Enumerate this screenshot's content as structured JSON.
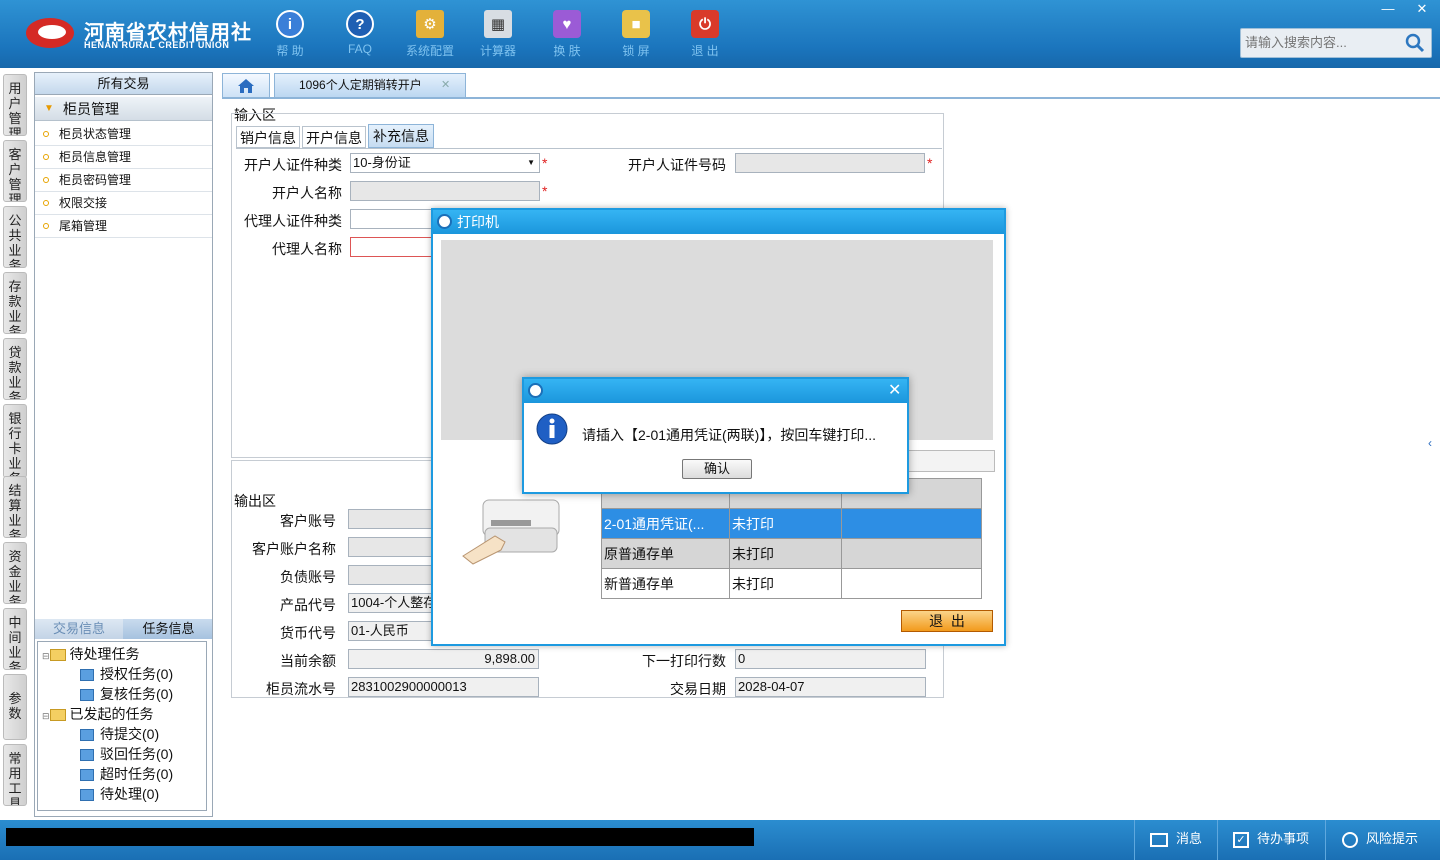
{
  "app": {
    "logo_cn": "河南省农村信用社",
    "logo_en": "HENAN RURAL CREDIT UNION",
    "toolbar": [
      {
        "label": "帮 助",
        "icon": "help-icon"
      },
      {
        "label": "FAQ",
        "icon": "faq-icon"
      },
      {
        "label": "系统配置",
        "icon": "config-icon"
      },
      {
        "label": "计算器",
        "icon": "calculator-icon"
      },
      {
        "label": "换 肤",
        "icon": "skin-icon"
      },
      {
        "label": "锁 屏",
        "icon": "lock-icon"
      },
      {
        "label": "退 出",
        "icon": "power-icon"
      }
    ],
    "search_placeholder": "请输入搜索内容..."
  },
  "vtabs": [
    "用户管理",
    "客户管理",
    "公共业务",
    "存款业务",
    "贷款业务",
    "银行卡业务",
    "结算业务",
    "资金业务",
    "中间业务",
    "参数",
    "常用工具"
  ],
  "nav": {
    "header": "所有交易",
    "group": "柜员管理",
    "items": [
      "柜员状态管理",
      "柜员信息管理",
      "柜员密码管理",
      "权限交接",
      "尾箱管理"
    ],
    "task_tabs": [
      "交易信息",
      "任务信息"
    ],
    "tree": [
      {
        "label": "待处理任务",
        "level": 0
      },
      {
        "label": "授权任务(0)",
        "level": 1
      },
      {
        "label": "复核任务(0)",
        "level": 1
      },
      {
        "label": "已发起的任务",
        "level": 0
      },
      {
        "label": "待提交(0)",
        "level": 1
      },
      {
        "label": "驳回任务(0)",
        "level": 1
      },
      {
        "label": "超时任务(0)",
        "level": 1
      },
      {
        "label": "待处理(0)",
        "level": 1
      }
    ]
  },
  "tabs": {
    "main": "1096个人定期销转开户"
  },
  "input_area": {
    "title": "输入区",
    "subtabs": [
      "销户信息",
      "开户信息",
      "补充信息"
    ],
    "fields": {
      "id_type_label": "开户人证件种类",
      "id_type_value": "10-身份证",
      "id_no_label": "开户人证件号码",
      "name_label": "开户人名称",
      "agent_id_type_label": "代理人证件种类",
      "agent_name_label": "代理人名称"
    }
  },
  "output_area": {
    "title": "输出区",
    "labels": [
      "客户账号",
      "客户账户名称",
      "负债账号",
      "产品代号",
      "货币代号",
      "当前余额",
      "柜员流水号"
    ],
    "product_code": "1004-个人整存",
    "currency_code": "01-人民币",
    "balance": "9,898.00",
    "teller_serial": "2831002900000013",
    "next_print_row_label": "下一打印行数",
    "next_print_row": "0",
    "trade_date_label": "交易日期",
    "trade_date": "2028-04-07"
  },
  "printer_dialog": {
    "title": "打印机",
    "rows": [
      {
        "name": "2-01通用凭证(...",
        "status": "未打印",
        "extra": ""
      },
      {
        "name": "原普通存单",
        "status": "未打印",
        "extra": ""
      },
      {
        "name": "新普通存单",
        "status": "未打印",
        "extra": ""
      }
    ],
    "exit_label": "退  出"
  },
  "message_dialog": {
    "text": "请插入【2-01通用凭证(两联)】，按回车键打印...",
    "confirm_label": "确认"
  },
  "status_bar": {
    "message": "消息",
    "todo": "待办事项",
    "risk": "风险提示"
  }
}
